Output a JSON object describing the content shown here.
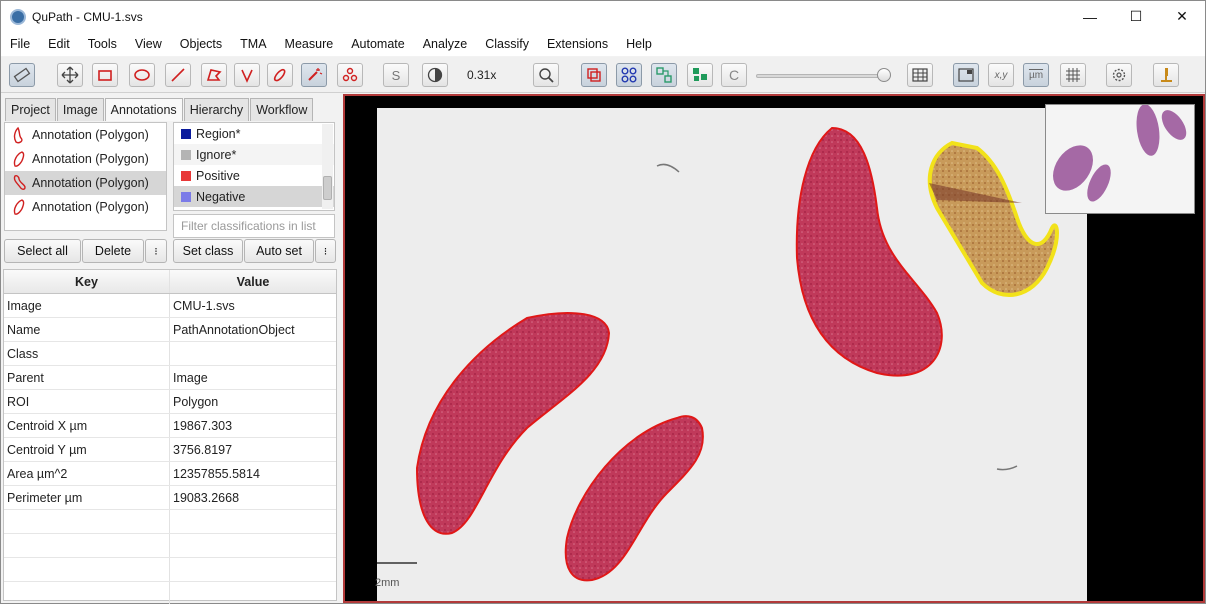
{
  "window": {
    "title": "QuPath - CMU-1.svs",
    "minimize": "—",
    "maximize": "☐",
    "close": "✕"
  },
  "menu": [
    "File",
    "Edit",
    "Tools",
    "View",
    "Objects",
    "TMA",
    "Measure",
    "Automate",
    "Analyze",
    "Classify",
    "Extensions",
    "Help"
  ],
  "toolbar": {
    "zoom": "0.31x",
    "s_label": "S",
    "c_label": "C",
    "xy_label": "x,y",
    "um_label": "µm"
  },
  "tabs": [
    "Project",
    "Image",
    "Annotations",
    "Hierarchy",
    "Workflow"
  ],
  "annotations": [
    "Annotation (Polygon)",
    "Annotation (Polygon)",
    "Annotation (Polygon)",
    "Annotation (Polygon)"
  ],
  "classes": [
    {
      "name": "Region*",
      "color": "#0a1a9c"
    },
    {
      "name": "Ignore*",
      "color": "#b4b4b4"
    },
    {
      "name": "Positive",
      "color": "#e83838"
    },
    {
      "name": "Negative",
      "color": "#7b7be8"
    }
  ],
  "filter_placeholder": "Filter classifications in list",
  "buttons": {
    "select_all": "Select all",
    "delete": "Delete",
    "set_class": "Set class",
    "auto_set": "Auto set",
    "more": "⁝"
  },
  "properties": {
    "key_header": "Key",
    "value_header": "Value",
    "rows": [
      {
        "key": "Image",
        "value": "CMU-1.svs"
      },
      {
        "key": "Name",
        "value": "PathAnnotationObject"
      },
      {
        "key": "Class",
        "value": ""
      },
      {
        "key": "Parent",
        "value": "Image"
      },
      {
        "key": "ROI",
        "value": "Polygon"
      },
      {
        "key": "Centroid X µm",
        "value": "19867.303"
      },
      {
        "key": "Centroid Y µm",
        "value": "3756.8197"
      },
      {
        "key": "Area µm^2",
        "value": "12357855.5814"
      },
      {
        "key": "Perimeter µm",
        "value": "19083.2668"
      }
    ]
  },
  "viewer": {
    "scalebar_label": "2mm"
  },
  "colors": {
    "annotation": "#e01818",
    "selected_annotation": "#f2e21a",
    "tissue": "#c0395a"
  }
}
